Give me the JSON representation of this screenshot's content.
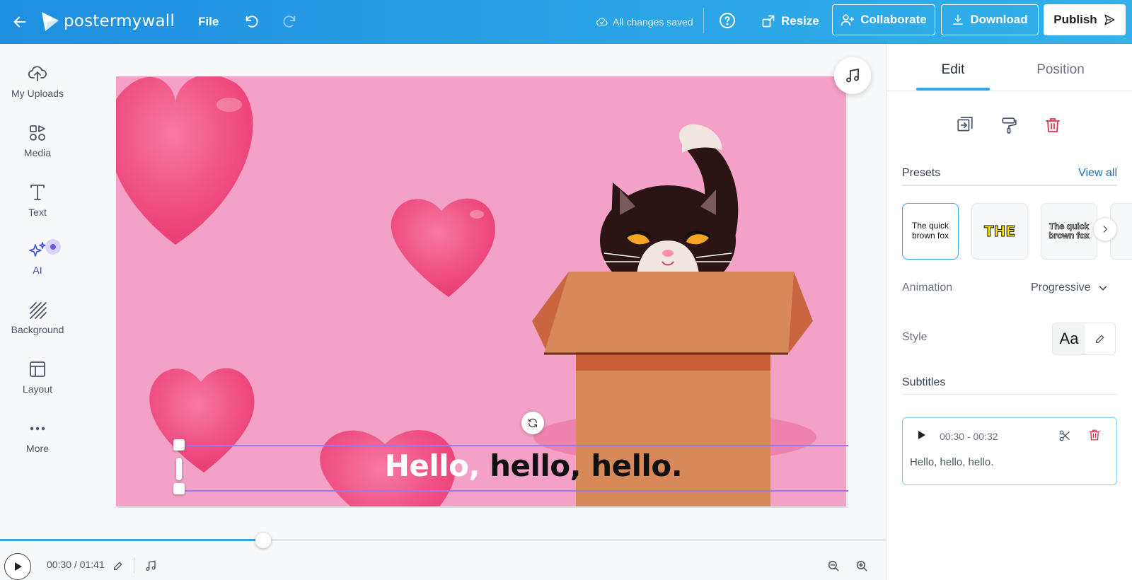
{
  "header": {
    "brand": "postermywall",
    "file_label": "File",
    "saved_status": "All changes saved",
    "resize_label": "Resize",
    "collaborate_label": "Collaborate",
    "download_label": "Download",
    "publish_label": "Publish"
  },
  "sidebar": {
    "items": [
      {
        "label": "My Uploads",
        "icon": "upload-cloud-icon"
      },
      {
        "label": "Media",
        "icon": "media-shapes-icon"
      },
      {
        "label": "Text",
        "icon": "text-t-icon"
      },
      {
        "label": "AI",
        "icon": "sparkles-icon"
      },
      {
        "label": "Background",
        "icon": "hatch-pattern-icon"
      },
      {
        "label": "Layout",
        "icon": "layout-grid-icon"
      },
      {
        "label": "More",
        "icon": "more-dots-icon"
      }
    ]
  },
  "canvas": {
    "background_color": "#f3a1c6",
    "subtitle_spoken": "Hello,",
    "subtitle_remaining": " hello, hello."
  },
  "timeline": {
    "time_display": "00:30 / 01:41",
    "progress": 0.297
  },
  "panel": {
    "tabs": [
      "Edit",
      "Position"
    ],
    "active_tab": "Edit",
    "presets_title": "Presets",
    "view_all": "View all",
    "presets": [
      "The quick brown fox",
      "THE",
      "The quick brown fox"
    ],
    "animation_label": "Animation",
    "animation_value": "Progressive",
    "style_label": "Style",
    "style_preview": "Aa",
    "subtitles_title": "Subtitles",
    "subtitle_entry": {
      "time": "00:30 - 00:32",
      "text": "Hello, hello, hello."
    }
  },
  "colors": {
    "accent": "#32a8e8",
    "delete": "#e0314b",
    "selection": "#9b7ae6"
  }
}
